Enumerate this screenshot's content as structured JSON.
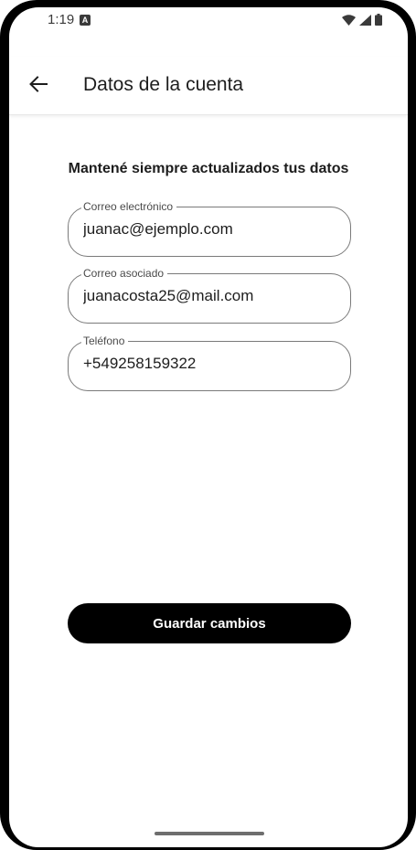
{
  "status_bar": {
    "time": "1:19",
    "notification_icon": "A",
    "icons": [
      "wifi-icon",
      "signal-icon",
      "battery-icon"
    ]
  },
  "app_bar": {
    "back_icon": "arrow-left-icon",
    "title": "Datos de la cuenta"
  },
  "main": {
    "subtitle": "Mantené siempre actualizados tus datos",
    "fields": [
      {
        "label": "Correo electrónico",
        "value": "juanac@ejemplo.com"
      },
      {
        "label": "Correo asociado",
        "value": "juanacosta25@mail.com"
      },
      {
        "label": "Teléfono",
        "value": "+549258159322"
      }
    ],
    "save_label": "Guardar cambios"
  },
  "colors": {
    "primary_button": "#000000",
    "field_border": "#7a7a7a",
    "text": "#1d1d1d"
  }
}
